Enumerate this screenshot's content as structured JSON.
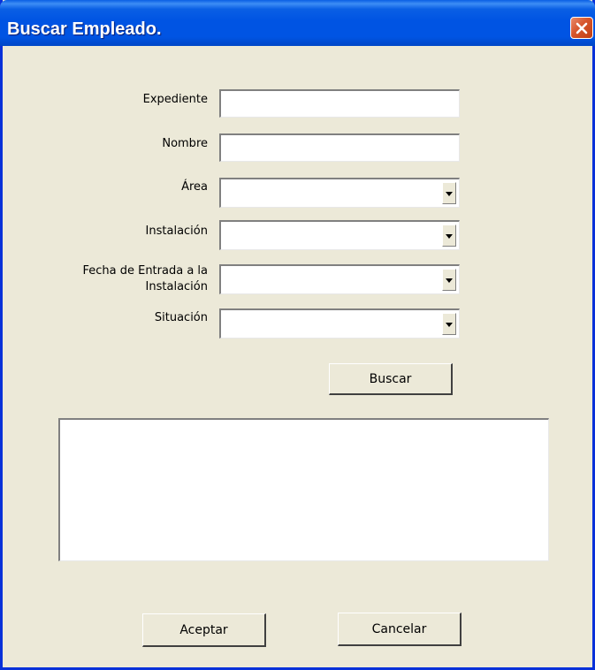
{
  "window": {
    "title": "Buscar Empleado.",
    "close_icon": "close-icon"
  },
  "colors": {
    "titlebar": "#0054e3",
    "dialog_bg": "#ece9d8",
    "close_button": "#d6552c"
  },
  "form": {
    "expediente": {
      "label": "Expediente",
      "value": ""
    },
    "nombre": {
      "label": "Nombre",
      "value": ""
    },
    "area": {
      "label": "Área",
      "value": ""
    },
    "instalacion": {
      "label": "Instalación",
      "value": ""
    },
    "fecha_entrada": {
      "label_line1": "Fecha de Entrada a la",
      "label_line2": "Instalación",
      "value": ""
    },
    "situacion": {
      "label": "Situación",
      "value": ""
    }
  },
  "buttons": {
    "buscar": "Buscar",
    "aceptar": "Aceptar",
    "cancelar": "Cancelar"
  },
  "results": {
    "items": []
  }
}
